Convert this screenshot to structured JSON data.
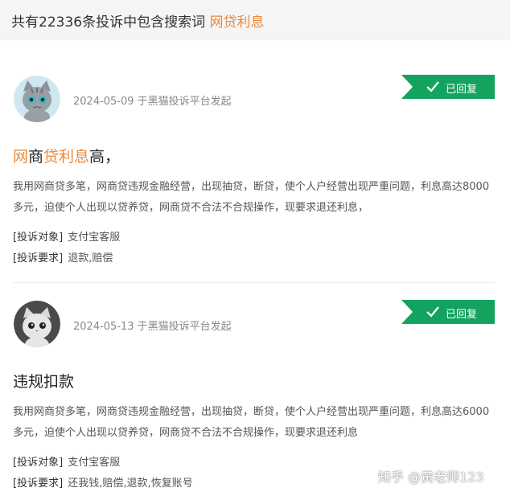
{
  "header": {
    "count_text": "共有22336条投诉中包含搜索词",
    "keyword": "网贷利息"
  },
  "complaints": [
    {
      "date_source": "2024-05-09 于黑猫投诉平台发起",
      "status": "已回复",
      "title_parts": [
        "网",
        "商",
        "贷利息",
        "高，"
      ],
      "body": "我用网商贷多笔，网商贷违规金融经营，出现抽贷，断贷，使个人户经营出现严重问题，利息高达8000多元，迫使个人出现以贷养贷，网商贷不合法不合规操作，现要求退还利息，",
      "target_label": "[投诉对象]",
      "target_value": "支付宝客服",
      "demand_label": "[投诉要求]",
      "demand_value": "退款,赔偿"
    },
    {
      "date_source": "2024-05-13 于黑猫投诉平台发起",
      "status": "已回复",
      "title": "违规扣款",
      "body": "我用网商贷多笔，网商贷违规金融经营，出现抽贷，断贷，使个人户经营出现严重问题，利息高达6000多元，迫使个人出现以贷养贷，网商贷不合法不合规操作，现要求退还利息",
      "target_label": "[投诉对象]",
      "target_value": "支付宝客服",
      "demand_label": "[投诉要求]",
      "demand_value": "还我钱,赔偿,退款,恢复账号"
    }
  ],
  "watermark": "知乎 @黄老师123",
  "colors": {
    "accent": "#e8893a",
    "badge_green": "#14a35f",
    "header_bg": "#f5f5f5"
  }
}
